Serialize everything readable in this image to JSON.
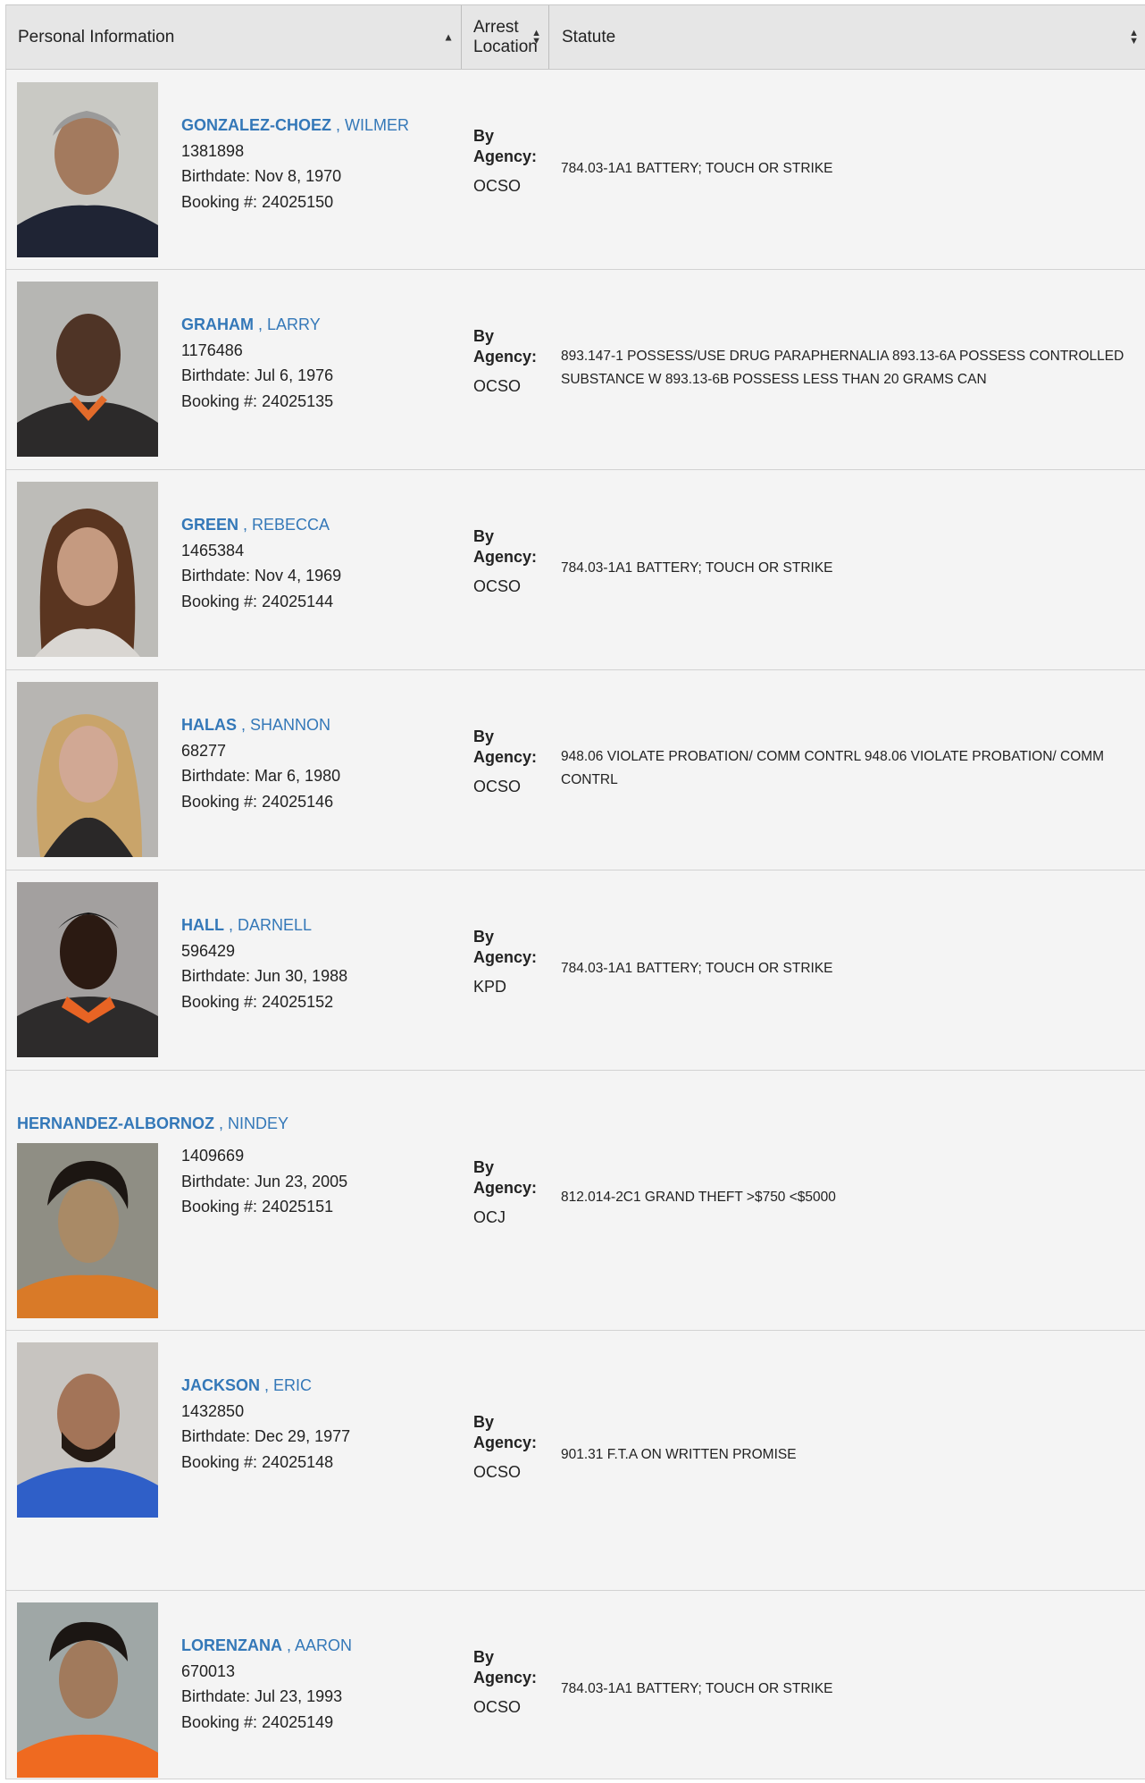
{
  "header": {
    "col_personal": "Personal Information",
    "col_arrest_line1": "Arrest",
    "col_arrest_line2": "Location",
    "col_statute": "Statute"
  },
  "labels": {
    "by": "By",
    "agency": "Agency:",
    "birthdate_prefix": "Birthdate: ",
    "booking_prefix": "Booking #: "
  },
  "inmates": [
    {
      "last": "GONZALEZ-CHOEZ",
      "first": "WILMER",
      "id": "1381898",
      "birthdate": "Nov 8, 1970",
      "booking": "24025150",
      "agency": "OCSO",
      "statute": "784.03-1A1 BATTERY; TOUCH OR STRIKE"
    },
    {
      "last": "GRAHAM",
      "first": "LARRY",
      "id": "1176486",
      "birthdate": "Jul 6, 1976",
      "booking": "24025135",
      "agency": "OCSO",
      "statute": "893.147-1 POSSESS/USE DRUG PARAPHERNALIA 893.13-6A POSSESS CONTROLLED SUBSTANCE W 893.13-6B POSSESS LESS THAN 20 GRAMS CAN"
    },
    {
      "last": "GREEN",
      "first": "REBECCA",
      "id": "1465384",
      "birthdate": "Nov 4, 1969",
      "booking": "24025144",
      "agency": "OCSO",
      "statute": "784.03-1A1 BATTERY; TOUCH OR STRIKE"
    },
    {
      "last": "HALAS",
      "first": "SHANNON",
      "id": "68277",
      "birthdate": "Mar 6, 1980",
      "booking": "24025146",
      "agency": "OCSO",
      "statute": "948.06 VIOLATE PROBATION/ COMM CONTRL 948.06 VIOLATE PROBATION/ COMM CONTRL"
    },
    {
      "last": "HALL",
      "first": "DARNELL",
      "id": "596429",
      "birthdate": "Jun 30, 1988",
      "booking": "24025152",
      "agency": "KPD",
      "statute": "784.03-1A1 BATTERY; TOUCH OR STRIKE"
    },
    {
      "last": "HERNANDEZ-ALBORNOZ",
      "first": "NINDEY",
      "id": "1409669",
      "birthdate": "Jun 23, 2005",
      "booking": "24025151",
      "agency": "OCJ",
      "statute": "812.014-2C1 GRAND THEFT >$750 <$5000"
    },
    {
      "last": "JACKSON",
      "first": "ERIC",
      "id": "1432850",
      "birthdate": "Dec 29, 1977",
      "booking": "24025148",
      "agency": "OCSO",
      "statute": "901.31 F.T.A ON WRITTEN PROMISE"
    },
    {
      "last": "LORENZANA",
      "first": "AARON",
      "id": "670013",
      "birthdate": "Jul 23, 1993",
      "booking": "24025149",
      "agency": "OCSO",
      "statute": "784.03-1A1 BATTERY; TOUCH OR STRIKE"
    }
  ],
  "colors": {
    "link": "#3478b8",
    "header_bg": "#e6e6e6",
    "row_bg": "#f4f4f4"
  }
}
